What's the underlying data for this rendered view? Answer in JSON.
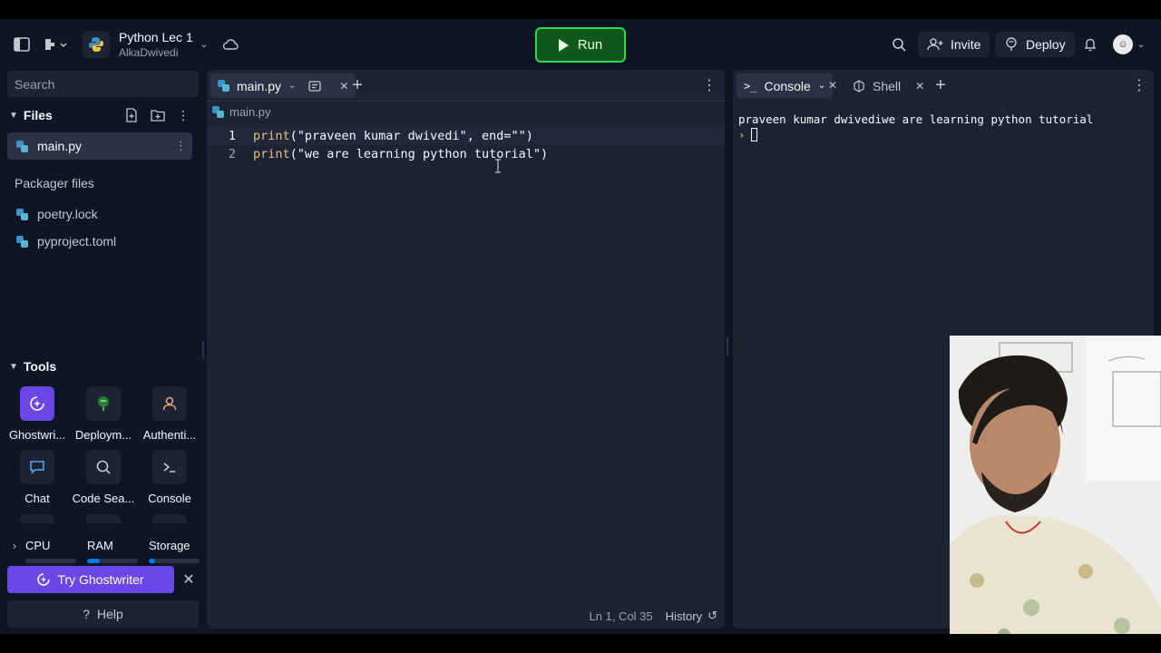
{
  "header": {
    "title": "Python Lec 1",
    "owner": "AlkaDwivedi",
    "run_label": "Run",
    "invite_label": "Invite",
    "deploy_label": "Deploy"
  },
  "sidebar": {
    "search_placeholder": "Search",
    "files_title": "Files",
    "files": [
      {
        "name": "main.py"
      }
    ],
    "packager_title": "Packager files",
    "packager_files": [
      {
        "name": "poetry.lock"
      },
      {
        "name": "pyproject.toml"
      }
    ],
    "tools_title": "Tools",
    "tools": [
      {
        "label": "Ghostwri..."
      },
      {
        "label": "Deploym..."
      },
      {
        "label": "Authenti..."
      },
      {
        "label": "Chat"
      },
      {
        "label": "Code Sea..."
      },
      {
        "label": "Console"
      }
    ],
    "resources": [
      {
        "label": "CPU",
        "fill": 0.0
      },
      {
        "label": "RAM",
        "fill": 0.25
      },
      {
        "label": "Storage",
        "fill": 0.12
      }
    ],
    "ghostwriter_label": "Try Ghostwriter",
    "help_label": "Help"
  },
  "editor": {
    "tab_label": "main.py",
    "breadcrumb": "main.py",
    "lines": [
      {
        "num": "1",
        "fn": "print",
        "rest": "(\"praveen kumar dwivedi\", end=\"\")"
      },
      {
        "num": "2",
        "fn": "print",
        "rest": "(\"we are learning python tutorial\")"
      }
    ],
    "position": "Ln 1, Col 35",
    "history_label": "History"
  },
  "console": {
    "console_tab": "Console",
    "shell_tab": "Shell",
    "output": "praveen kumar dwivediwe are learning python tutorial",
    "prompt_symbol": "›"
  }
}
